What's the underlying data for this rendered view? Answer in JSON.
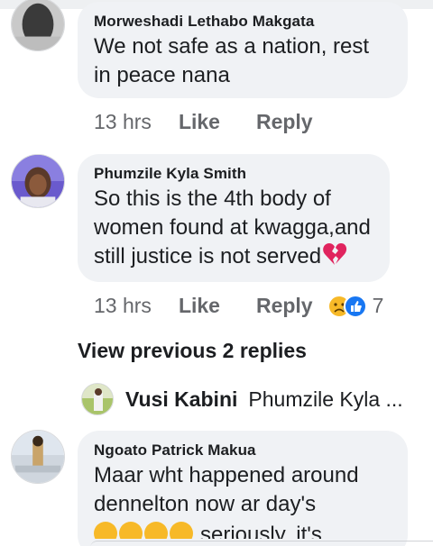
{
  "comments": [
    {
      "author": "Morweshadi Lethabo Makgata",
      "text": "We not safe as a nation, rest in peace nana",
      "time": "13 hrs",
      "like": "Like",
      "reply": "Reply"
    },
    {
      "author": "Phumzile Kyla Smith",
      "text": "So this is the 4th body  of women found at kwagga,and still justice is not served",
      "emoji": "broken-heart",
      "time": "13 hrs",
      "like": "Like",
      "reply": "Reply",
      "reaction_count": "7",
      "reactions": [
        "sad-reaction-icon",
        "like-reaction-icon"
      ]
    },
    {
      "author": "Ngoato Patrick Makua",
      "text": "Maar  wht happened around dennelton now ar day's",
      "text_cut": "seriously, it's"
    }
  ],
  "view_previous": "View previous 2 replies",
  "reply_preview": {
    "name": "Vusi Kabini",
    "snippet": "Phumzile Kyla ..."
  },
  "colors": {
    "bubble": "#f0f2f5",
    "meta": "#65676b",
    "like_blue": "#1877f2",
    "sad_yellow": "#f7b928",
    "heart_red": "#e0245e"
  }
}
